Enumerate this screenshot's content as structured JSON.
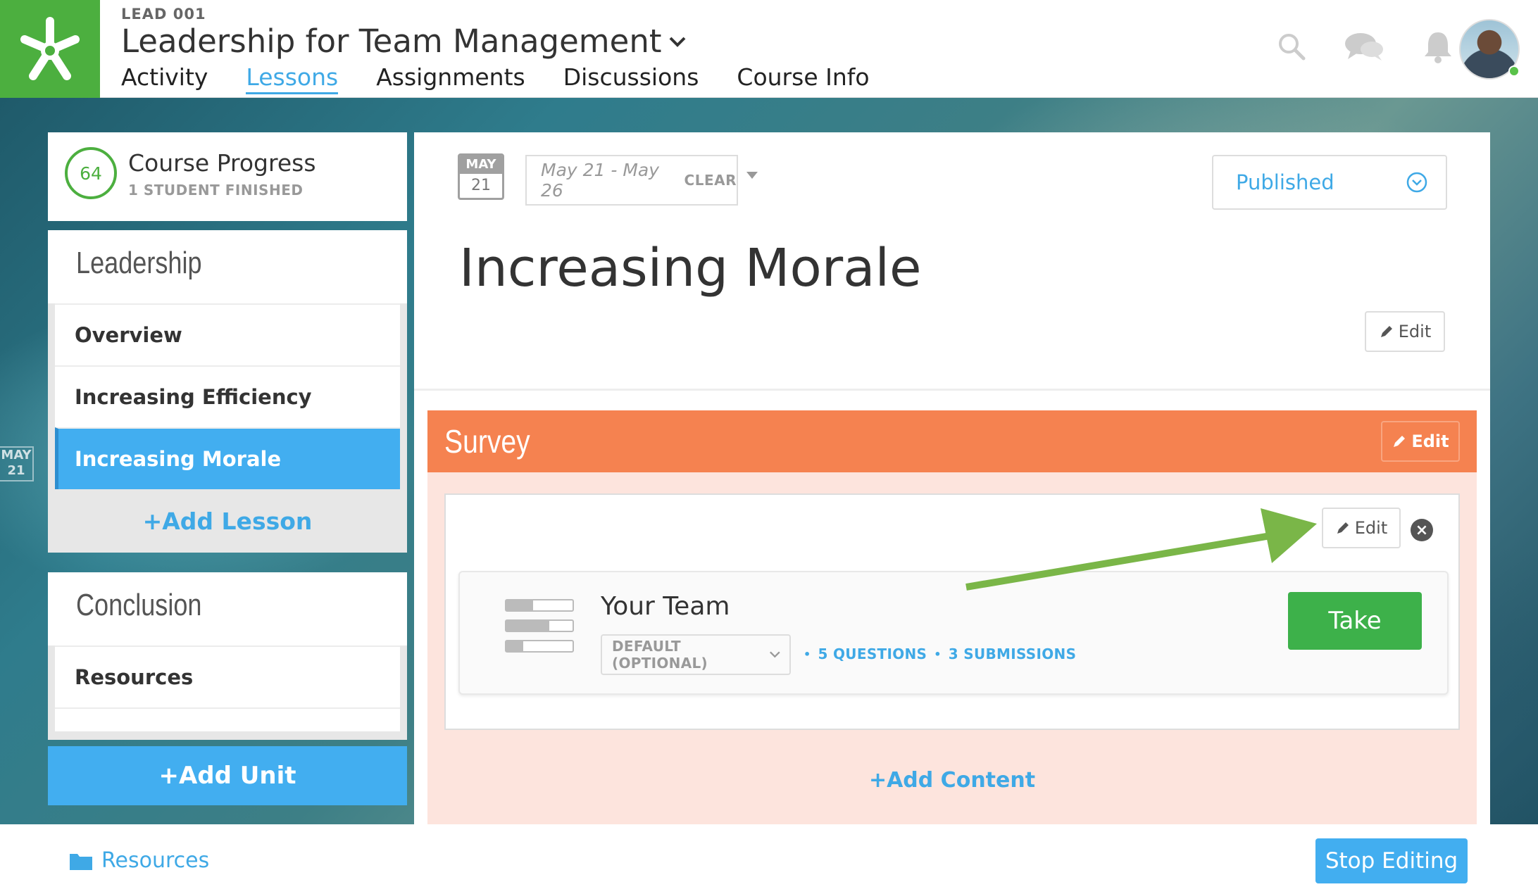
{
  "header": {
    "course_code": "LEAD 001",
    "course_title": "Leadership for Team Management",
    "tabs": [
      {
        "label": "Activity"
      },
      {
        "label": "Lessons"
      },
      {
        "label": "Assignments"
      },
      {
        "label": "Discussions"
      },
      {
        "label": "Course Info"
      }
    ],
    "active_tab": "Lessons",
    "icons": [
      "search-icon",
      "chat-icon",
      "bell-icon"
    ],
    "brand_color": "#4caf3f"
  },
  "side_date": {
    "month": "MAY",
    "day": "21"
  },
  "progress": {
    "value": "64",
    "title": "Course Progress",
    "subtitle": "1 STUDENT FINISHED"
  },
  "sidebar": {
    "units": [
      {
        "title": "Leadership",
        "lessons": [
          {
            "label": "Overview"
          },
          {
            "label": "Increasing Efficiency"
          },
          {
            "label": "Increasing Morale"
          }
        ],
        "add_lesson": "+Add Lesson"
      },
      {
        "title": "Conclusion",
        "lessons": [
          {
            "label": "Resources"
          }
        ]
      }
    ],
    "active_lesson": "Increasing Morale",
    "add_unit": "+Add Unit"
  },
  "main": {
    "calendar": {
      "month": "MAY",
      "day": "21"
    },
    "date_range": "May 21 - May 26",
    "clear_label": "CLEAR",
    "status": "Published",
    "lesson_title": "Increasing Morale",
    "edit_label": "Edit",
    "survey": {
      "title": "Survey",
      "edit_label": "Edit",
      "box_edit_label": "Edit",
      "item": {
        "title": "Your Team",
        "grading": "DEFAULT (OPTIONAL)",
        "questions": "5 QUESTIONS",
        "submissions": "3 SUBMISSIONS",
        "take_label": "Take"
      },
      "add_content": "+Add Content",
      "header_color": "#f58250"
    }
  },
  "footer": {
    "resources_label": "Resources",
    "stop_editing": "Stop Editing"
  }
}
